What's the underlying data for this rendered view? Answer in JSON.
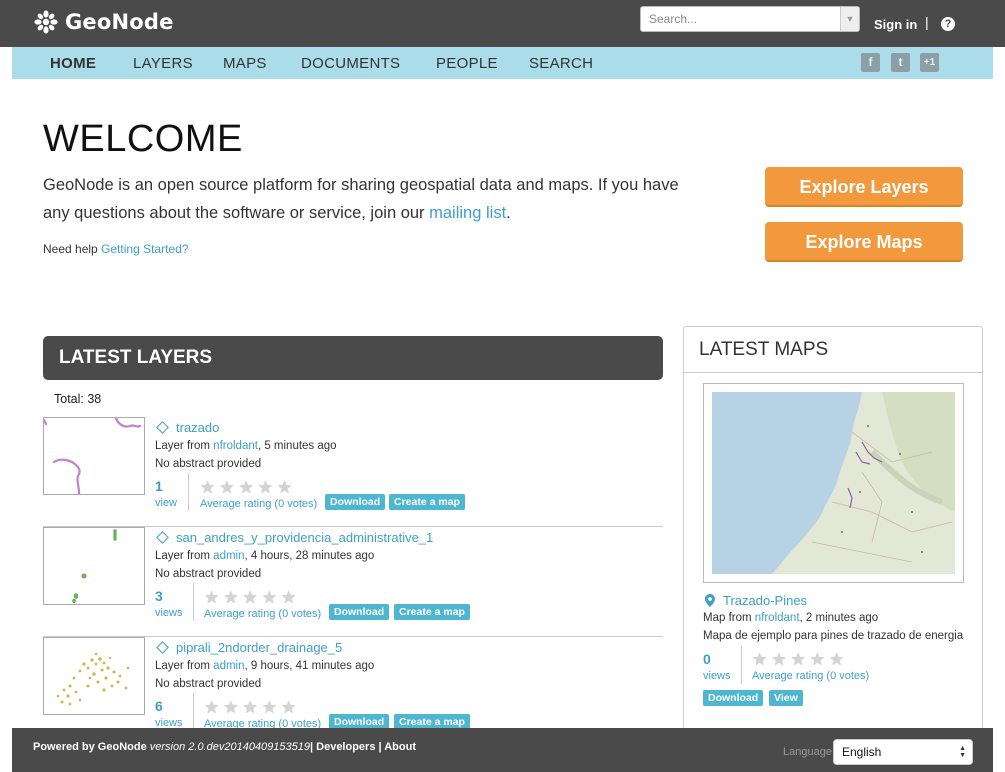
{
  "brand": {
    "name": "GeoNode",
    "icon": "geonode-flower-icon"
  },
  "topbar": {
    "search_placeholder": "Search...",
    "signin": "Sign in",
    "separator": "|",
    "help_icon": "?"
  },
  "nav": {
    "items": [
      {
        "label": "HOME",
        "active": true
      },
      {
        "label": "LAYERS"
      },
      {
        "label": "MAPS"
      },
      {
        "label": "DOCUMENTS"
      },
      {
        "label": "PEOPLE"
      },
      {
        "label": "SEARCH"
      }
    ],
    "social": [
      {
        "icon": "facebook-icon",
        "glyph": "f"
      },
      {
        "icon": "twitter-icon",
        "glyph": "t"
      },
      {
        "icon": "google-plus-icon",
        "glyph": "+1"
      }
    ]
  },
  "welcome": {
    "title": "WELCOME",
    "intro_before": "GeoNode is an open source platform for sharing geospatial data and maps. If you have any questions about the software or service, join our ",
    "intro_link": "mailing list",
    "intro_after": ".",
    "help_prefix": "Need help ",
    "help_link": "Getting Started?",
    "explore_layers": "Explore Layers",
    "explore_maps": "Explore Maps"
  },
  "latest_layers": {
    "title": "LATEST LAYERS",
    "total": "Total: 38",
    "items": [
      {
        "name": "trazado",
        "meta_prefix": "Layer from ",
        "owner": "nfroldant",
        "meta_suffix": ", 5 minutes ago",
        "abstract": "No abstract provided",
        "count": "1",
        "count_label": "view",
        "rating": "Average rating (0 votes)",
        "download": "Download",
        "create_map": "Create a map"
      },
      {
        "name": "san_andres_y_providencia_administrative_1",
        "meta_prefix": "Layer from ",
        "owner": "admin",
        "meta_suffix": ", 4 hours, 28 minutes ago",
        "abstract": "No abstract provided",
        "count": "3",
        "count_label": "views",
        "rating": "Average rating (0 votes)",
        "download": "Download",
        "create_map": "Create a map"
      },
      {
        "name": "piprali_2ndorder_drainage_5",
        "meta_prefix": "Layer from ",
        "owner": "admin",
        "meta_suffix": ", 9 hours, 41 minutes ago",
        "abstract": "No abstract provided",
        "count": "6",
        "count_label": "views",
        "rating": "Average rating (0 votes)",
        "download": "Download",
        "create_map": "Create a map"
      }
    ]
  },
  "latest_maps": {
    "title": "LATEST MAPS",
    "items": [
      {
        "name": "Trazado-Pines",
        "meta_prefix": "Map from ",
        "owner": "nfroldant",
        "meta_suffix": ", 2 minutes ago",
        "description": "Mapa de ejemplo para pines de trazado de energia",
        "count": "0",
        "count_label": "views",
        "rating": "Average rating (0 votes)",
        "download": "Download",
        "view": "View"
      }
    ]
  },
  "footer": {
    "powered": "Powered by GeoNode ",
    "version": "version 2.0.dev20140409153519",
    "links": "| Developers | About",
    "language_label": "Language",
    "language_value": "English"
  },
  "colors": {
    "topbar": "#4a4a4a",
    "nav": "#abdce9",
    "link": "#3d9fc7",
    "cta": "#f1993c",
    "button": "#4fb6d1"
  }
}
